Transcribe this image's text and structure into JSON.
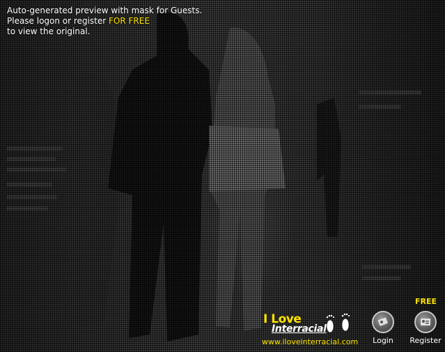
{
  "notice": {
    "line1": "Auto-generated preview with mask for Guests.",
    "line2_prefix": "Please logon or register ",
    "line2_highlight": "FOR FREE",
    "line3": "to view the original."
  },
  "brand": {
    "line1": "I Love",
    "line2": "Interracial",
    "url": "www.iloveinterracial.com"
  },
  "actions": {
    "free_badge": "FREE",
    "login_label": "Login",
    "register_label": "Register"
  },
  "colors": {
    "accent": "#ffe400",
    "text": "#ffffff",
    "background": "#2a2a2a"
  },
  "icons": {
    "login": "key-card-icon",
    "register": "id-card-icon",
    "brand": "footprints-icon"
  }
}
